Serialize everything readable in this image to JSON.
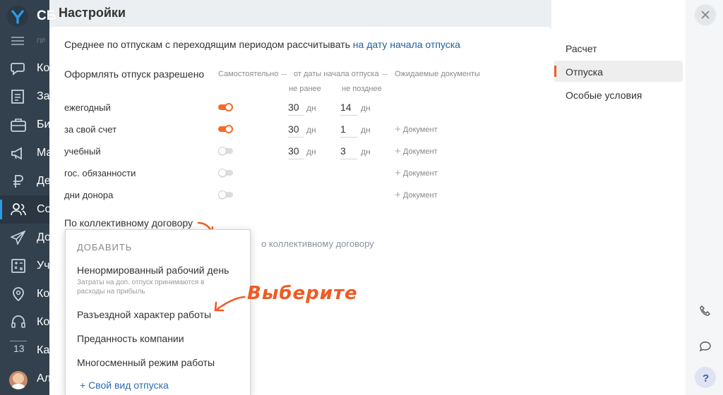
{
  "sidebar": {
    "logo_text": "СБ",
    "section_label": "ПР",
    "items": [
      {
        "label": "Кон",
        "icon": "chat-icon"
      },
      {
        "label": "Зад",
        "icon": "checklist-icon"
      },
      {
        "label": "Биз",
        "icon": "briefcase-icon"
      },
      {
        "label": "Мар",
        "icon": "megaphone-icon"
      },
      {
        "label": "Ден",
        "icon": "ruble-icon"
      },
      {
        "label": "Сот",
        "icon": "people-icon"
      },
      {
        "label": "Док",
        "icon": "send-icon"
      },
      {
        "label": "Уче",
        "icon": "calculator-icon"
      },
      {
        "label": "Кон",
        "icon": "map-pin-icon"
      },
      {
        "label": "Кон",
        "icon": "headset-icon"
      },
      {
        "label": "Кал",
        "icon": "calendar-icon"
      },
      {
        "label": "Ал",
        "icon": "avatar"
      }
    ],
    "calendar_day": "13"
  },
  "modal": {
    "title": "Настройки",
    "avg_text": "Среднее по отпускам с переходящим периодом рассчитывать",
    "avg_link": "на дату начала отпуска",
    "allowed_label": "Оформлять отпуск разрешено",
    "col_self": "Самостоятельно",
    "col_from_start": "от даты начала отпуска",
    "col_not_earlier": "не ранее",
    "col_not_later": "не позднее",
    "col_docs": "Ожидаемые документы",
    "unit": "дн",
    "add_doc": "Документ",
    "rows": [
      {
        "name": "ежегодный",
        "self": true,
        "not_earlier": "30",
        "not_later": "14",
        "docs": ""
      },
      {
        "name": "за свой счет",
        "self": true,
        "not_earlier": "30",
        "not_later": "1",
        "docs": "Документ"
      },
      {
        "name": "учебный",
        "self": false,
        "not_earlier": "30",
        "not_later": "3",
        "docs": "Документ"
      },
      {
        "name": "гос. обязанности",
        "self": false,
        "not_earlier": "",
        "not_later": "",
        "docs": "Документ"
      },
      {
        "name": "дни донора",
        "self": false,
        "not_earlier": "",
        "not_later": "",
        "docs": "Документ"
      }
    ],
    "collective_label": "По коллективному договору",
    "collective_ghost": "о коллективному договору"
  },
  "dropdown": {
    "header": "ДОБАВИТЬ",
    "items": [
      {
        "label": "Ненормированный рабочий день",
        "sub": "Затраты на доп. отпуск принимаются в расходы на прибыль"
      },
      {
        "label": "Разъездной характер работы"
      },
      {
        "label": "Преданность компании"
      },
      {
        "label": "Многосменный режим работы"
      }
    ],
    "custom_label": "+ Свой вид отпуска"
  },
  "annotation": "Выберите",
  "right_nav": {
    "items": [
      "Расчет",
      "Отпуска",
      "Особые условия"
    ],
    "active": "Отпуска"
  },
  "colors": {
    "accent": "#f56b2a",
    "link": "#1f5f9e",
    "sidebar": "#33414e"
  }
}
